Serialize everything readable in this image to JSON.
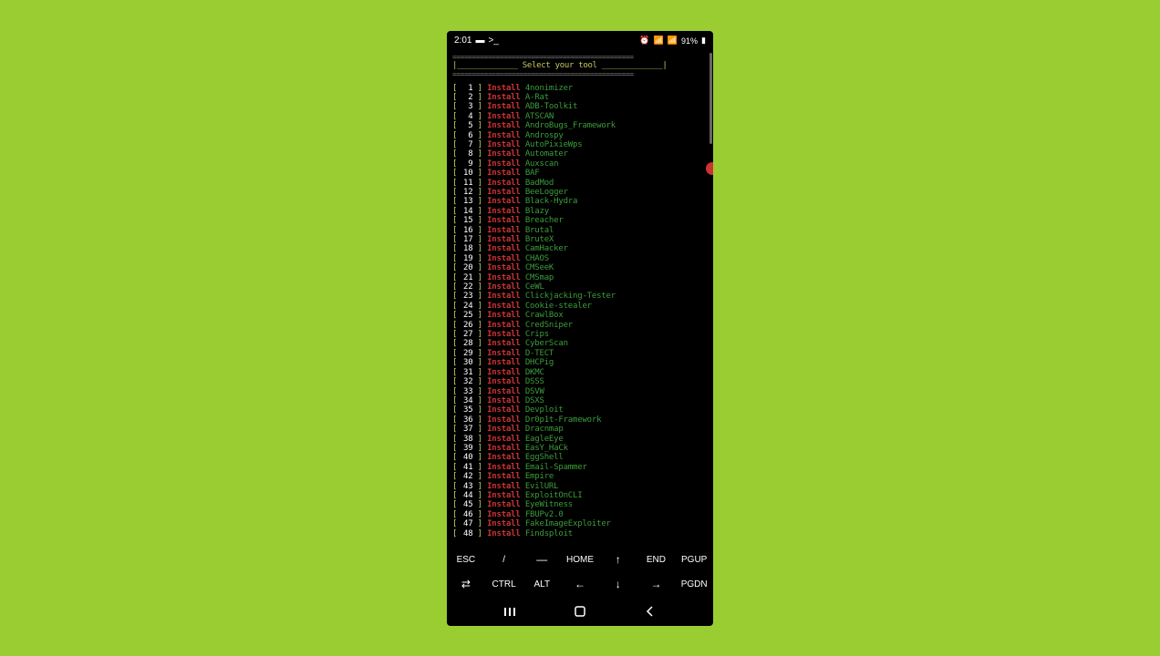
{
  "status": {
    "time": "2:01",
    "battery": "91%"
  },
  "terminal": {
    "title": "Select your tool",
    "action": "Install",
    "tools": [
      {
        "n": 1,
        "name": "4nonimizer"
      },
      {
        "n": 2,
        "name": "A-Rat"
      },
      {
        "n": 3,
        "name": "ADB-Toolkit"
      },
      {
        "n": 4,
        "name": "ATSCAN"
      },
      {
        "n": 5,
        "name": "AndroBugs_Framework"
      },
      {
        "n": 6,
        "name": "Androspy"
      },
      {
        "n": 7,
        "name": "AutoPixieWps"
      },
      {
        "n": 8,
        "name": "Automater"
      },
      {
        "n": 9,
        "name": "Auxscan"
      },
      {
        "n": 10,
        "name": "BAF"
      },
      {
        "n": 11,
        "name": "BadMod"
      },
      {
        "n": 12,
        "name": "BeeLogger"
      },
      {
        "n": 13,
        "name": "Black-Hydra"
      },
      {
        "n": 14,
        "name": "Blazy"
      },
      {
        "n": 15,
        "name": "Breacher"
      },
      {
        "n": 16,
        "name": "Brutal"
      },
      {
        "n": 17,
        "name": "BruteX"
      },
      {
        "n": 18,
        "name": "CamHacker"
      },
      {
        "n": 19,
        "name": "CHAOS"
      },
      {
        "n": 20,
        "name": "CMSeeK"
      },
      {
        "n": 21,
        "name": "CMSmap"
      },
      {
        "n": 22,
        "name": "CeWL"
      },
      {
        "n": 23,
        "name": "Clickjacking-Tester"
      },
      {
        "n": 24,
        "name": "Cookie-stealer"
      },
      {
        "n": 25,
        "name": "CrawlBox"
      },
      {
        "n": 26,
        "name": "CredSniper"
      },
      {
        "n": 27,
        "name": "Crips"
      },
      {
        "n": 28,
        "name": "CyberScan"
      },
      {
        "n": 29,
        "name": "D-TECT"
      },
      {
        "n": 30,
        "name": "DHCPig"
      },
      {
        "n": 31,
        "name": "DKMC"
      },
      {
        "n": 32,
        "name": "DSSS"
      },
      {
        "n": 33,
        "name": "DSVW"
      },
      {
        "n": 34,
        "name": "DSXS"
      },
      {
        "n": 35,
        "name": "Devploit"
      },
      {
        "n": 36,
        "name": "Dr0p1t-Framework"
      },
      {
        "n": 37,
        "name": "Dracnmap"
      },
      {
        "n": 38,
        "name": "EagleEye"
      },
      {
        "n": 39,
        "name": "EasY_HaCk"
      },
      {
        "n": 40,
        "name": "EggShell"
      },
      {
        "n": 41,
        "name": "Email-Spammer"
      },
      {
        "n": 42,
        "name": "Empire"
      },
      {
        "n": 43,
        "name": "EvilURL"
      },
      {
        "n": 44,
        "name": "ExploitOnCLI"
      },
      {
        "n": 45,
        "name": "EyeWitness"
      },
      {
        "n": 46,
        "name": "FBUPv2.0"
      },
      {
        "n": 47,
        "name": "FakeImageExploiter"
      },
      {
        "n": 48,
        "name": "Findsploit"
      }
    ]
  },
  "keys": {
    "row1": [
      "ESC",
      "/",
      "—",
      "HOME",
      "↑",
      "END",
      "PGUP"
    ],
    "row2": [
      "⇄",
      "CTRL",
      "ALT",
      "←",
      "↓",
      "→",
      "PGDN"
    ]
  }
}
